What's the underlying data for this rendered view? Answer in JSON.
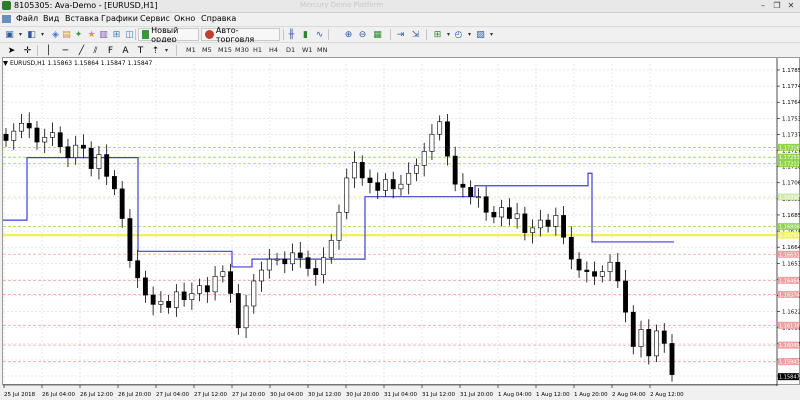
{
  "window": {
    "title": "8105305: Ava-Demo - [EURUSD,H1]",
    "faint_title": "Mercury Demo Platform"
  },
  "menu": [
    "Файл",
    "Вид",
    "Вставка",
    "Графики",
    "Сервис",
    "Окно",
    "Справка"
  ],
  "toolbar": {
    "new_order_label": "Новый ордер",
    "auto_trading_label": "Авто-торговля",
    "timeframes": [
      "M1",
      "M5",
      "M15",
      "M30",
      "H1",
      "H4",
      "D1",
      "W1",
      "MN"
    ]
  },
  "chart": {
    "header": "EURUSD,H1  1.15863 1.15864 1.15847 1.15847",
    "symbol": "EURUSD",
    "period": "H1",
    "ohlc": [
      1.15863,
      1.15864,
      1.15847,
      1.15847
    ],
    "current_price": "1.15847",
    "price_ticks": [
      "1.17850",
      "1.17745",
      "1.17640",
      "1.17535",
      "1.17375",
      "1.17270",
      "1.17165",
      "1.17060",
      "1.16955",
      "1.16850",
      "1.16745",
      "1.16640",
      "1.16535",
      "1.16430",
      "1.16325",
      "1.16220",
      "1.16115",
      "1.16010",
      "1.15905",
      "1.15800"
    ],
    "right_axis_badges": [
      {
        "value": "1.17316",
        "color": "#8fd44a"
      },
      {
        "value": "1.17253",
        "color": "#8fd44a"
      },
      {
        "value": "1.17211",
        "color": "#8fd44a"
      },
      {
        "value": "1.16998",
        "color": "#cfe9a8"
      },
      {
        "value": "1.16808",
        "color": "#8fd44a"
      },
      {
        "value": "1.16754",
        "color": "#f0f06a"
      },
      {
        "value": "1.16631",
        "color": "#f0a0a0"
      },
      {
        "value": "1.16464",
        "color": "#f0a0a0"
      },
      {
        "value": "1.16374",
        "color": "#f0a0a0"
      },
      {
        "value": "1.16176",
        "color": "#f0a0a0"
      },
      {
        "value": "1.16049",
        "color": "#f0a0a0"
      },
      {
        "value": "1.15943",
        "color": "#f0a0a0"
      },
      {
        "value": "1.15847",
        "color": "#000000"
      }
    ],
    "time_labels": [
      "25 Jul 2018",
      "26 Jul 04:00",
      "26 Jul 12:00",
      "26 Jul 20:00",
      "27 Jul 04:00",
      "27 Jul 12:00",
      "27 Jul 20:00",
      "30 Jul 04:00",
      "30 Jul 12:00",
      "30 Jul 20:00",
      "31 Jul 04:00",
      "31 Jul 12:00",
      "31 Jul 20:00",
      "1 Aug 04:00",
      "1 Aug 12:00",
      "1 Aug 20:00",
      "2 Aug 04:00",
      "2 Aug 12:00"
    ],
    "colors": {
      "candle": "#000000",
      "indicator": "#4040d0",
      "resistance_level": "#b8e070",
      "support_level": "#f0a0a0",
      "highlight_level": "#f0f060",
      "grid": "#d8d8d8"
    }
  },
  "chart_data": {
    "type": "candlestick",
    "symbol": "EURUSD",
    "timeframe": "H1",
    "y_range": [
      1.158,
      1.1785
    ],
    "indicator_step_line": [
      {
        "segment": 1,
        "value": 1.1685
      },
      {
        "segment": 2,
        "value": 1.1725
      },
      {
        "segment": 3,
        "value": 1.1665
      },
      {
        "segment": 4,
        "value": 1.1655
      },
      {
        "segment": 5,
        "value": 1.166
      },
      {
        "segment": 6,
        "value": 1.17
      },
      {
        "segment": 7,
        "value": 1.1707
      },
      {
        "segment": 8,
        "value": 1.1715
      },
      {
        "segment": 9,
        "value": 1.1671
      }
    ],
    "approx_closes": [
      1.1736,
      1.1742,
      1.1747,
      1.1744,
      1.1735,
      1.1738,
      1.1741,
      1.1732,
      1.1725,
      1.1733,
      1.1731,
      1.1718,
      1.1727,
      1.1713,
      1.1705,
      1.1686,
      1.1659,
      1.1648,
      1.1637,
      1.1631,
      1.1633,
      1.1629,
      1.1639,
      1.1634,
      1.1638,
      1.1643,
      1.1639,
      1.1649,
      1.1652,
      1.1638,
      1.1616,
      1.163,
      1.1646,
      1.1653,
      1.166,
      1.166,
      1.1657,
      1.1664,
      1.1661,
      1.1654,
      1.165,
      1.1661,
      1.1672,
      1.169,
      1.1712,
      1.1722,
      1.1712,
      1.1709,
      1.1704,
      1.1711,
      1.1705,
      1.1708,
      1.1715,
      1.172,
      1.1729,
      1.174,
      1.1748,
      1.1726,
      1.1708,
      1.1706,
      1.17,
      1.17,
      1.169,
      1.1687,
      1.1693,
      1.1686,
      1.1689,
      1.1677,
      1.168,
      1.1685,
      1.1681,
      1.1688,
      1.1674,
      1.166,
      1.1653,
      1.1652,
      1.1649,
      1.1652,
      1.1658,
      1.1646,
      1.1626,
      1.1604,
      1.1615,
      1.1598,
      1.1614,
      1.1606,
      1.1586
    ]
  }
}
